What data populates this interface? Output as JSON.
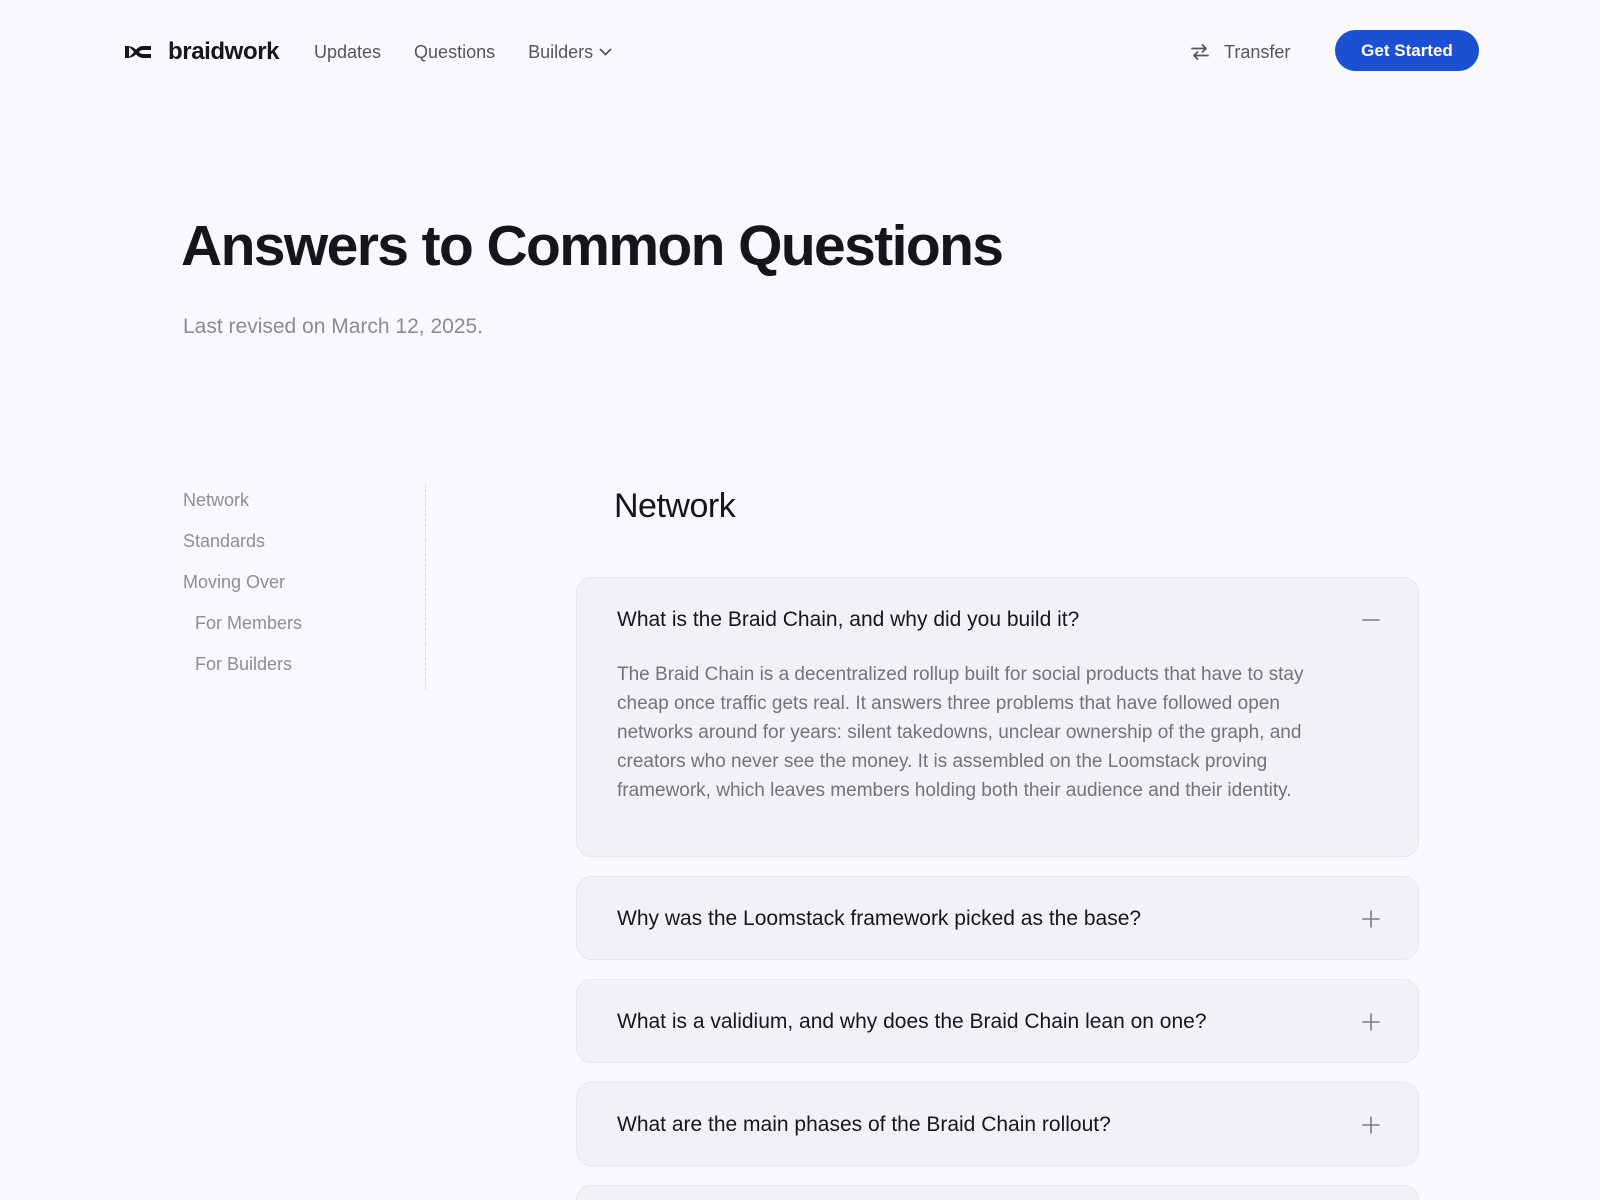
{
  "header": {
    "brand": "braidwork",
    "nav": [
      {
        "label": "Updates"
      },
      {
        "label": "Questions"
      },
      {
        "label": "Builders",
        "has_dropdown": true
      }
    ],
    "transfer_label": "Transfer",
    "cta_label": "Get Started"
  },
  "hero": {
    "title": "Answers to Common Questions",
    "subtitle": "Last revised on March 12, 2025."
  },
  "sidebar": {
    "items": [
      {
        "label": "Network"
      },
      {
        "label": "Standards"
      },
      {
        "label": "Moving Over"
      },
      {
        "label": "For Members"
      },
      {
        "label": "For Builders"
      }
    ]
  },
  "main": {
    "section_title": "Network",
    "faqs": [
      {
        "question": "What is the Braid Chain, and why did you build it?",
        "expanded": true,
        "answer": "The Braid Chain is a decentralized rollup built for social products that have to stay cheap once traffic gets real. It answers three problems that have followed open networks around for years: silent takedowns, unclear ownership of the graph, and creators who never see the money. It is assembled on the Loomstack proving framework, which leaves members holding both their audience and their identity."
      },
      {
        "question": "Why was the Loomstack framework picked as the base?",
        "expanded": false
      },
      {
        "question": "What is a validium, and why does the Braid Chain lean on one?",
        "expanded": false
      },
      {
        "question": "What are the main phases of the Braid Chain rollout?",
        "expanded": false
      }
    ]
  },
  "colors": {
    "background": "#f9f8fd",
    "accent": "#1c4fd1",
    "card": "#f2f1f7"
  }
}
